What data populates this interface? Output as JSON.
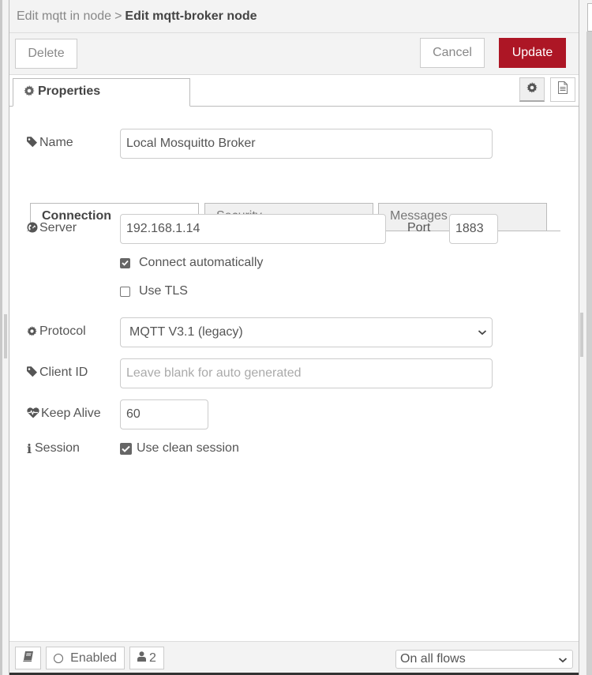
{
  "header": {
    "breadcrumb_parent": "Edit mqtt in node",
    "separator": ">",
    "title": "Edit mqtt-broker node"
  },
  "toolbar": {
    "delete_label": "Delete",
    "cancel_label": "Cancel",
    "update_label": "Update"
  },
  "tabs": {
    "properties_label": "Properties",
    "icons": [
      "gear-icon",
      "document-icon"
    ]
  },
  "form": {
    "name": {
      "label": "Name",
      "value": "Local Mosquitto Broker",
      "icon": "tag-icon"
    },
    "subtabs": [
      {
        "label": "Connection",
        "active": true
      },
      {
        "label": "Security",
        "active": false
      },
      {
        "label": "Messages",
        "active": false
      }
    ],
    "server": {
      "label": "Server",
      "value": "192.168.1.14",
      "icon": "globe-icon"
    },
    "port": {
      "label": "Port",
      "value": "1883"
    },
    "connect_automatically": {
      "label": "Connect automatically",
      "checked": true
    },
    "use_tls": {
      "label": "Use TLS",
      "checked": false
    },
    "protocol": {
      "label": "Protocol",
      "selected": "MQTT V3.1 (legacy)",
      "icon": "gear-icon"
    },
    "client_id": {
      "label": "Client ID",
      "value": "",
      "placeholder": "Leave blank for auto generated",
      "icon": "tag-icon"
    },
    "keep_alive": {
      "label": "Keep Alive",
      "value": "60",
      "icon": "heartbeat-icon"
    },
    "session": {
      "label": "Session",
      "checkbox_label": "Use clean session",
      "checked": true,
      "icon": "info-icon"
    }
  },
  "footer": {
    "enabled_label": "Enabled",
    "users_count": "2",
    "scope_selected": "On all flows"
  },
  "colors": {
    "primary_button": "#ad1625",
    "header_background": "#f3f3f3"
  }
}
